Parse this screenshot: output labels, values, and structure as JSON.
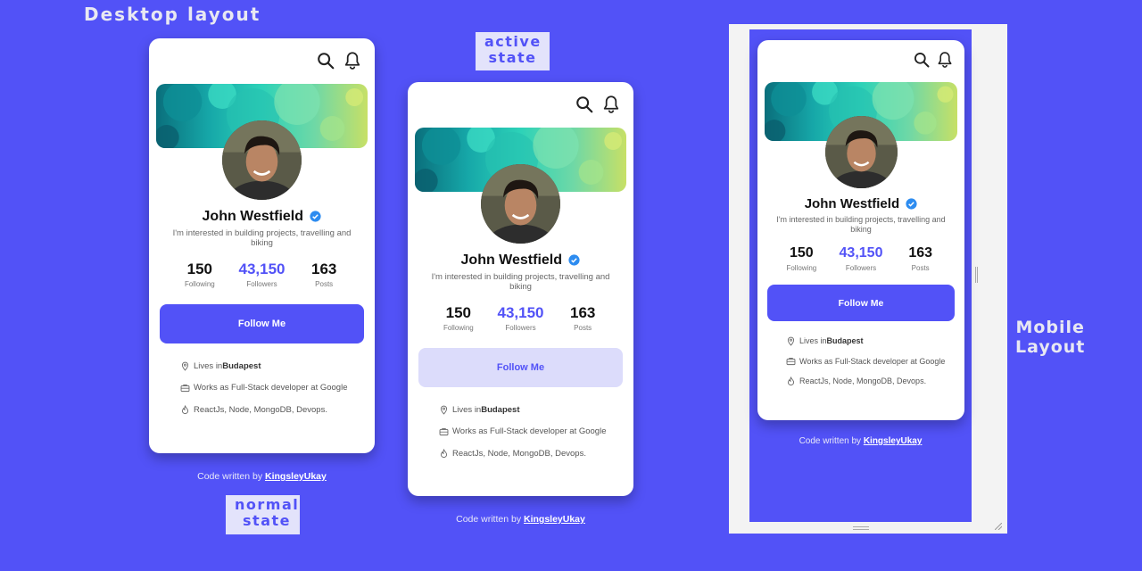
{
  "labels": {
    "desktop": "Desktop layout",
    "active_line1": "active",
    "active_line2": "state",
    "normal_line1": "normal",
    "normal_line2": "state",
    "mobile_line1": "Mobile",
    "mobile_line2": "Layout"
  },
  "profile": {
    "name": "John Westfield",
    "bio": "I'm interested in building projects, travelling and biking",
    "stats": [
      {
        "value": "150",
        "label": "Following"
      },
      {
        "value": "43,150",
        "label": "Followers"
      },
      {
        "value": "163",
        "label": "Posts"
      }
    ],
    "follow_label": "Follow Me",
    "info": {
      "location_prefix": "Lives in ",
      "location": "Budapest",
      "work": "Works as Full-Stack developer at Google",
      "skills": "ReactJs, Node, MongoDB, Devops."
    }
  },
  "credit": {
    "prefix": "Code written by ",
    "author": "KingsleyUkay"
  },
  "icons": {
    "search": "search-icon",
    "bell": "bell-icon",
    "verified": "verified-check-icon",
    "location": "location-pin-icon",
    "work": "briefcase-icon",
    "skills": "flame-icon"
  },
  "colors": {
    "background": "#5252f7",
    "accent": "#5252f7",
    "follow_active_bg": "#dcdcfb",
    "verified": "#2d8cf0"
  }
}
